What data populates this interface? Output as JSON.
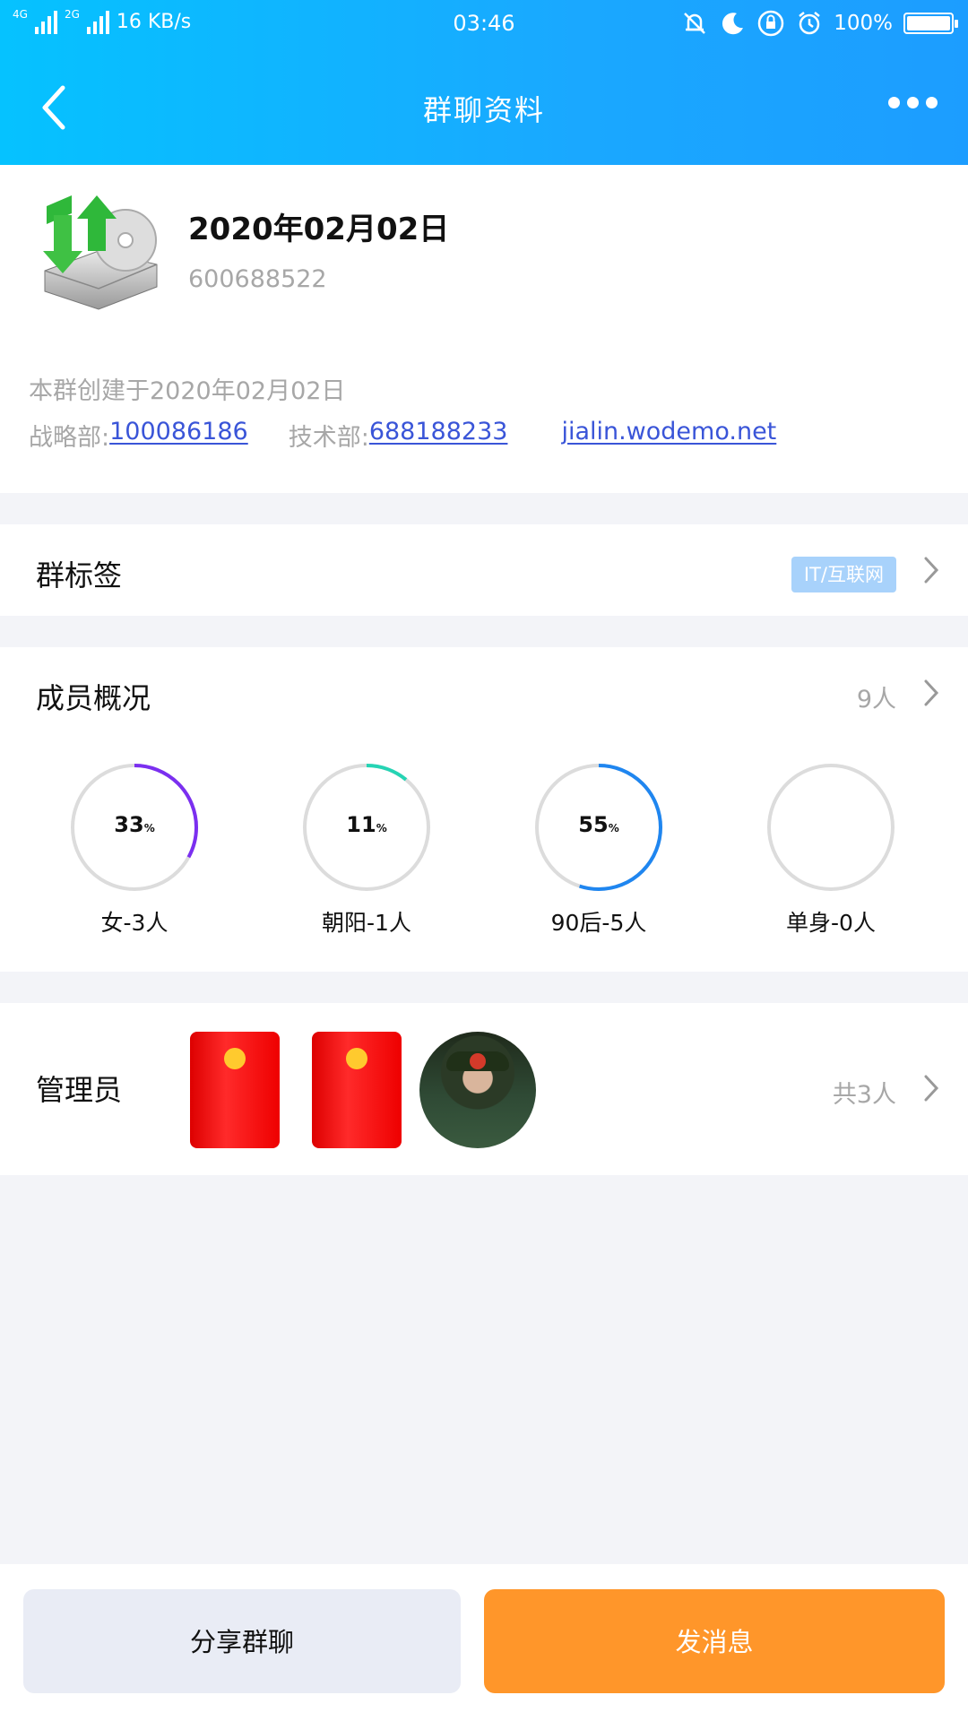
{
  "status_bar": {
    "network_4g": "4G",
    "network_2g": "2G",
    "speed": "16 KB/s",
    "time": "03:46",
    "battery": "100%"
  },
  "nav": {
    "title": "群聊资料"
  },
  "group": {
    "name": "2020年02月02日",
    "id": "600688522",
    "created": "本群创建于2020年02月02日",
    "links": [
      {
        "label": "战略部:",
        "value": "100086186"
      },
      {
        "label": "技术部:",
        "value": "688188233"
      },
      {
        "label": "",
        "value": "jialin.wodemo.net"
      }
    ]
  },
  "tags": {
    "title": "群标签",
    "badge": "IT/互联网"
  },
  "members": {
    "title": "成员概况",
    "count": "9人",
    "stats": [
      {
        "percent": 33,
        "percent_text": "33",
        "unit": "%",
        "label": "女-3人",
        "color": "#7b2ff0"
      },
      {
        "percent": 11,
        "percent_text": "11",
        "unit": "%",
        "label": "朝阳-1人",
        "color": "#25d4b4"
      },
      {
        "percent": 55,
        "percent_text": "55",
        "unit": "%",
        "label": "90后-5人",
        "color": "#1f86f0"
      },
      {
        "percent": 0,
        "percent_text": "",
        "unit": "",
        "label": "单身-0人",
        "color": "#1f86f0"
      }
    ]
  },
  "admins": {
    "title": "管理员",
    "count": "共3人",
    "avatars": [
      "constitution-book",
      "constitution-book",
      "military-portrait"
    ]
  },
  "actions": {
    "share": "分享群聊",
    "send": "发消息"
  }
}
